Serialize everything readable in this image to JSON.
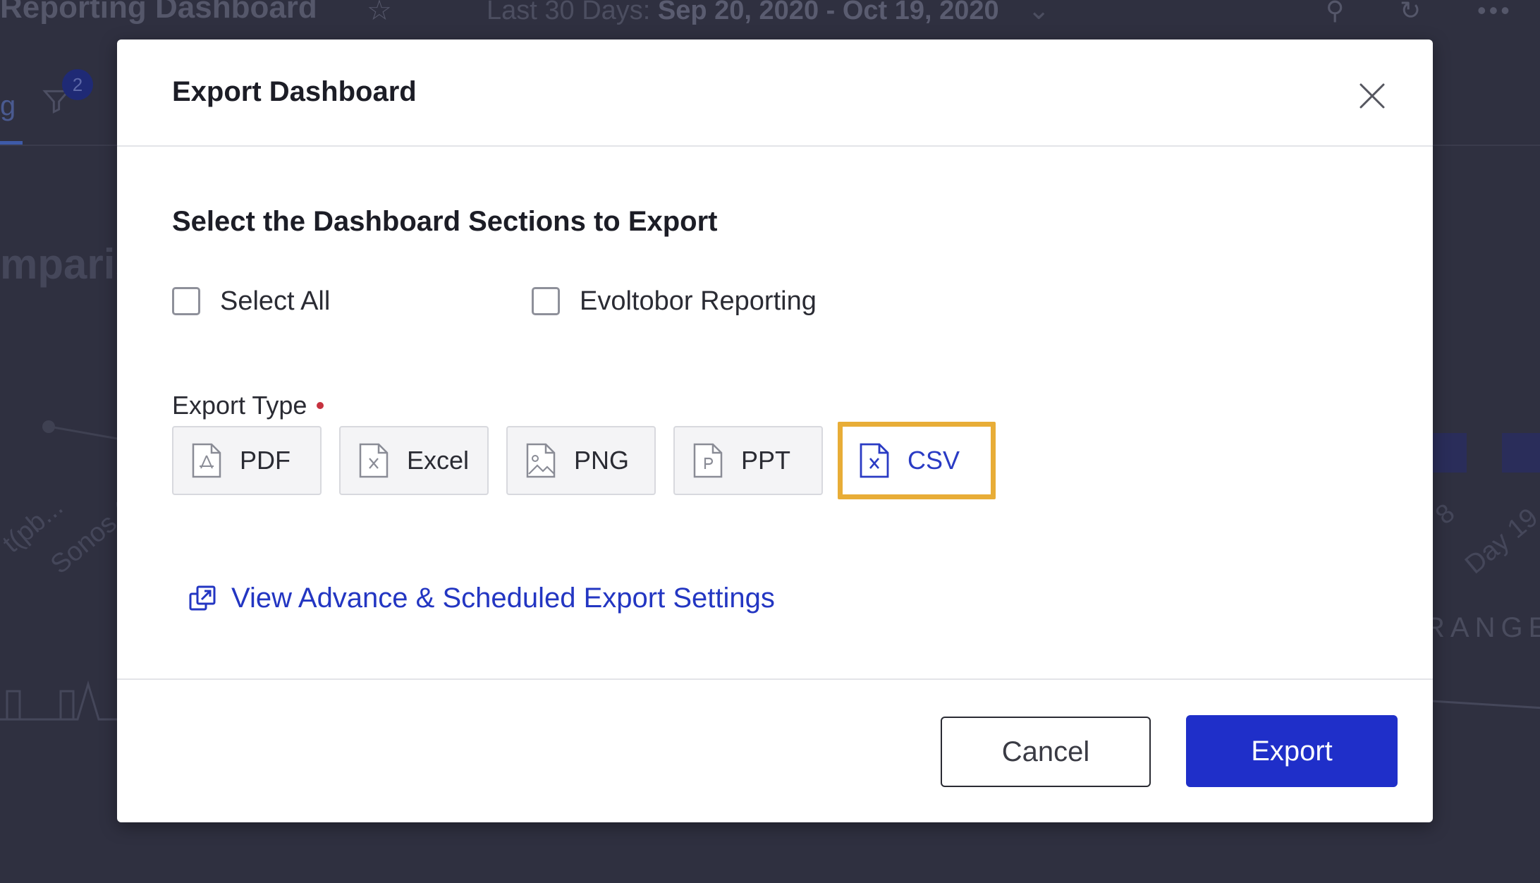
{
  "background": {
    "dashboard_title": "Reporting Dashboard",
    "date_range_prefix": "Last 30 Days:",
    "date_range_value": "Sep 20, 2020 - Oct 19, 2020",
    "tab_partial": "g",
    "filter_badge_count": "2",
    "heading_partial": "mparis",
    "x_labels": [
      "t(pb...",
      "Sonos (",
      "8",
      "Day 19"
    ],
    "range_partial": "RANGE"
  },
  "modal": {
    "title": "Export Dashboard",
    "section_title": "Select the Dashboard Sections to Export",
    "checkboxes": [
      {
        "label": "Select All",
        "checked": false
      },
      {
        "label": "Evoltobor Reporting",
        "checked": false
      }
    ],
    "export_type_label": "Export Type",
    "export_types": [
      {
        "label": "PDF",
        "icon": "pdf-file-icon",
        "selected": false
      },
      {
        "label": "Excel",
        "icon": "excel-file-icon",
        "selected": false
      },
      {
        "label": "PNG",
        "icon": "image-file-icon",
        "selected": false
      },
      {
        "label": "PPT",
        "icon": "ppt-file-icon",
        "selected": false
      },
      {
        "label": "CSV",
        "icon": "csv-file-icon",
        "selected": true
      }
    ],
    "advanced_link": "View Advance & Scheduled Export Settings",
    "cancel_label": "Cancel",
    "export_label": "Export"
  },
  "colors": {
    "primary": "#1f2fc9",
    "link": "#2336c2",
    "highlight": "#e8ad37",
    "required": "#c6323f"
  }
}
